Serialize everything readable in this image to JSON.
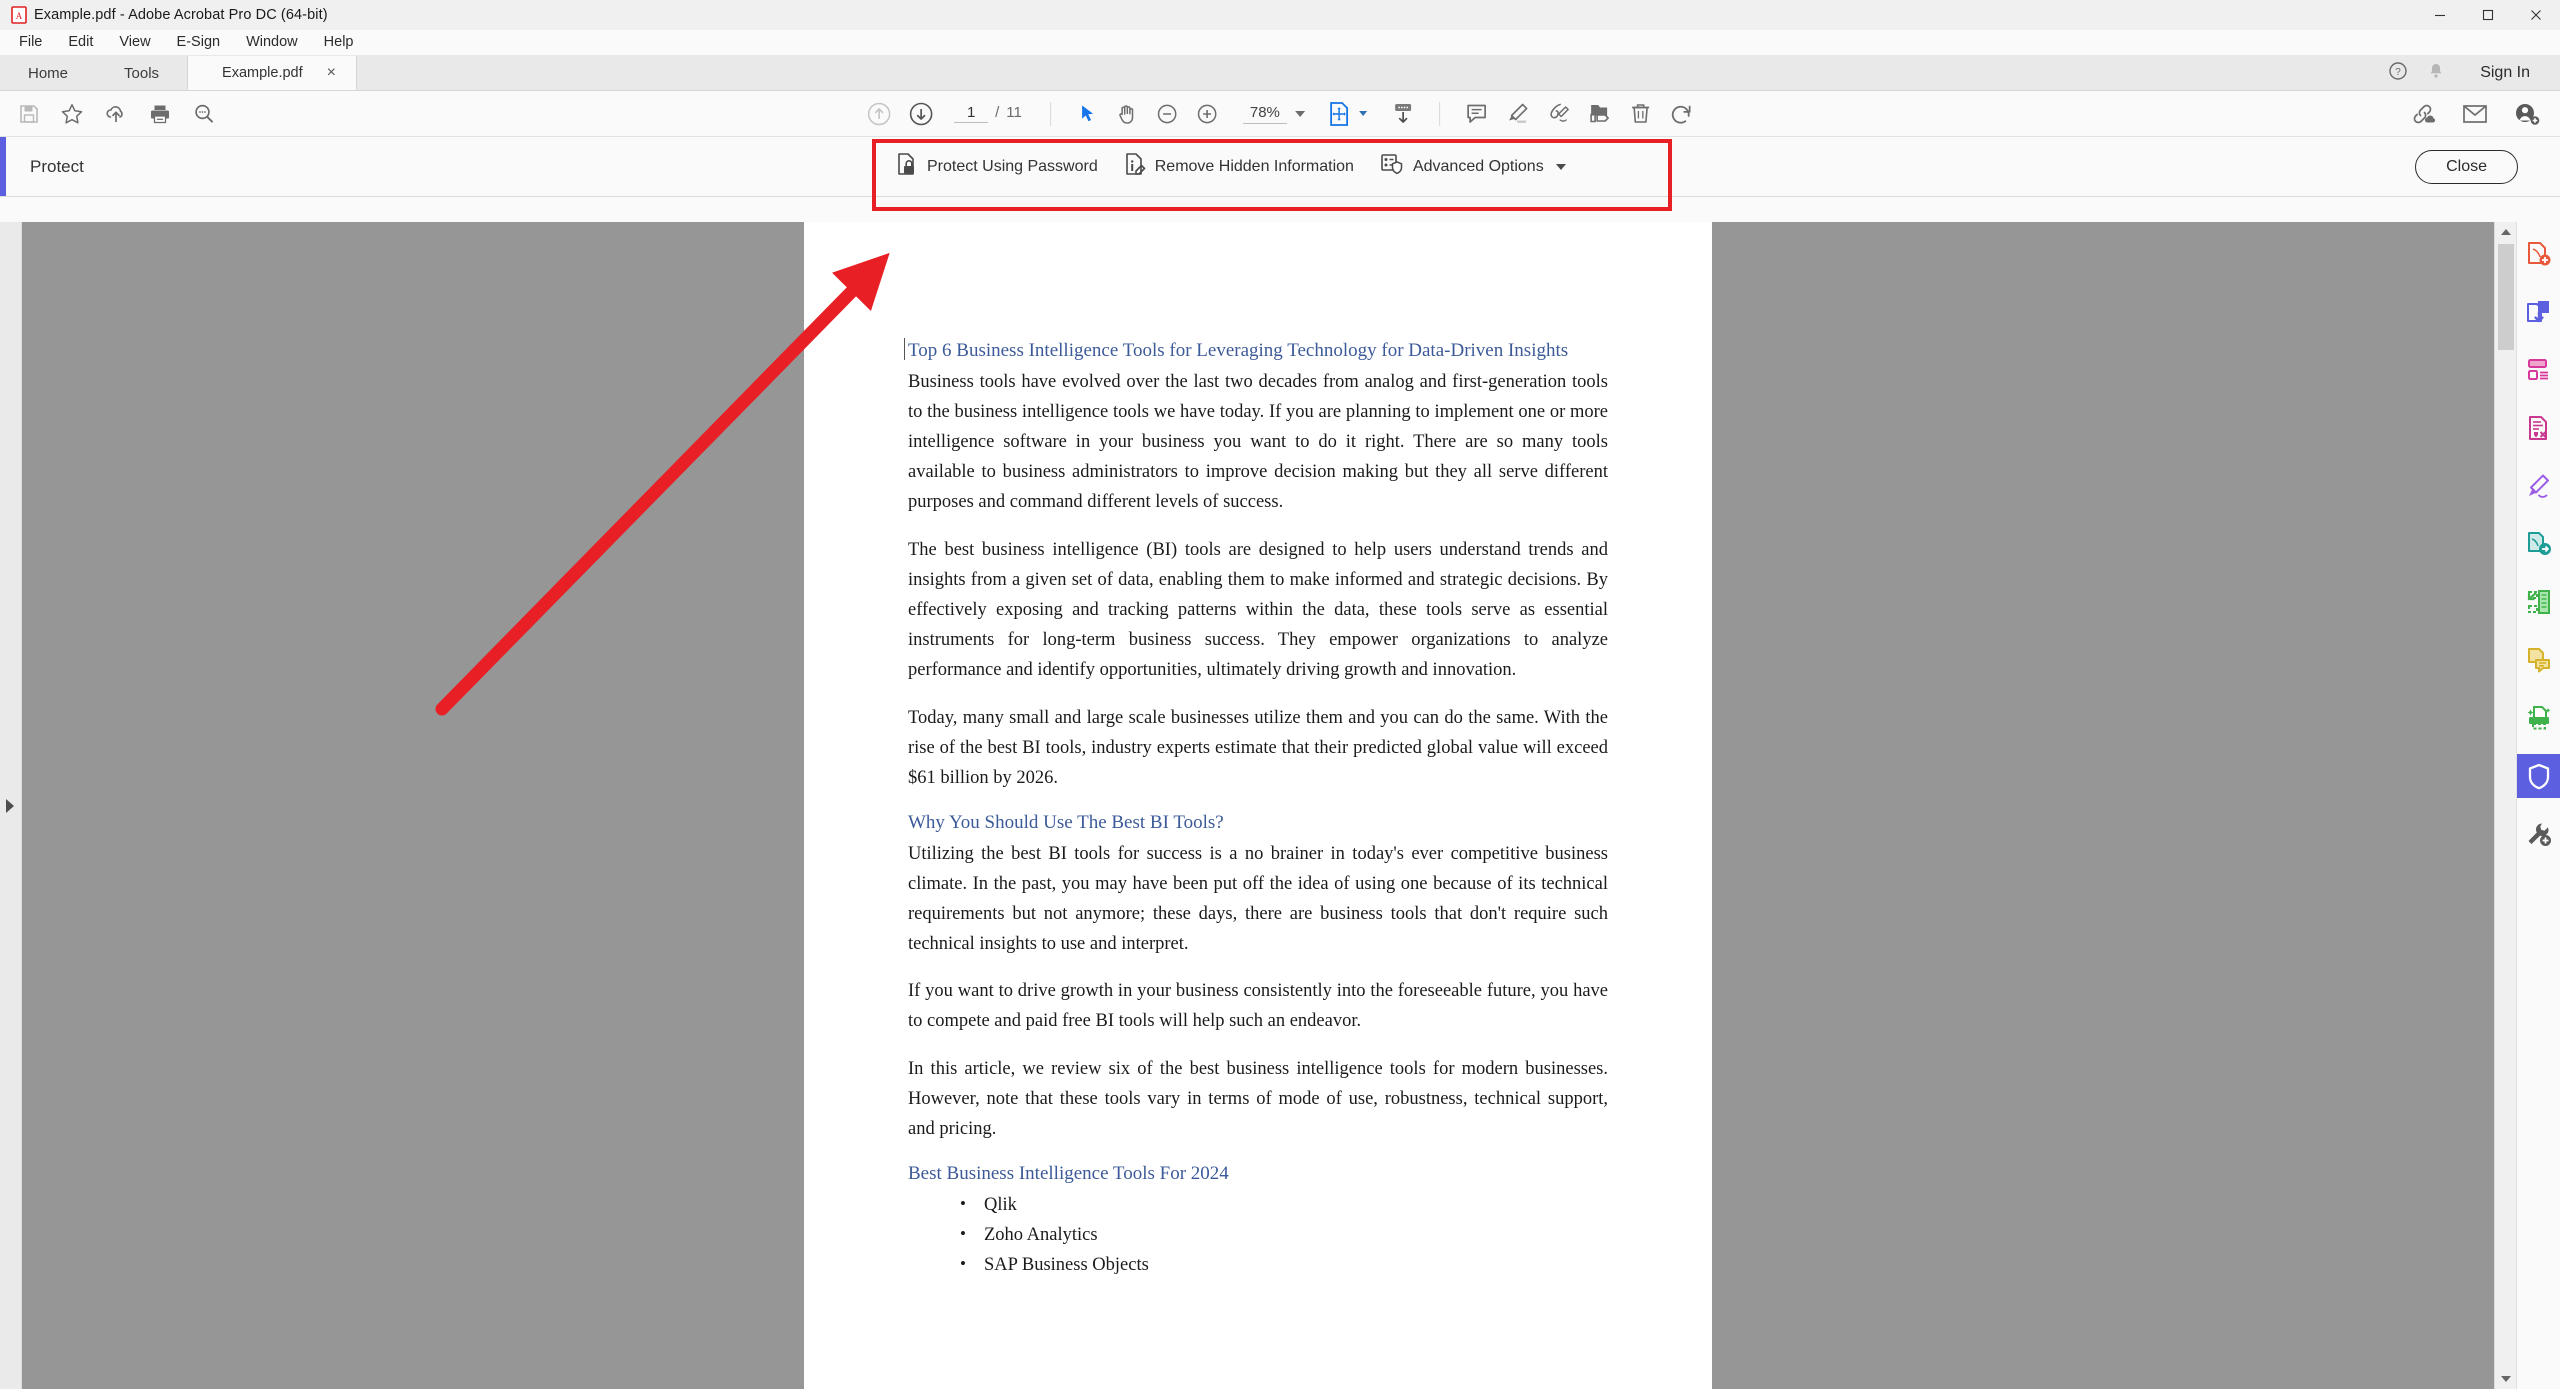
{
  "window": {
    "title": "Example.pdf - Adobe Acrobat Pro DC (64-bit)",
    "app_icon": "pdf-file-icon",
    "minimize": "—",
    "maximize": "❐",
    "close": "✕"
  },
  "menubar": {
    "items": [
      {
        "label": "File",
        "accel": "F"
      },
      {
        "label": "Edit",
        "accel": "E"
      },
      {
        "label": "View",
        "accel": "V"
      },
      {
        "label": "E-Sign",
        "accel": ""
      },
      {
        "label": "Window",
        "accel": "W"
      },
      {
        "label": "Help",
        "accel": "H"
      }
    ]
  },
  "tabs": {
    "home": "Home",
    "tools": "Tools",
    "document": "Example.pdf",
    "close_glyph": "×",
    "sign_in": "Sign In",
    "help_icon": "help-circle-icon",
    "bell_icon": "notification-bell-icon"
  },
  "toolbar": {
    "left_icons": [
      "save-icon",
      "star-icon",
      "cloud-upload-icon",
      "print-icon",
      "search-icon"
    ],
    "prev_page_icon": "arrow-up-circle-icon",
    "next_page_icon": "arrow-down-circle-icon",
    "page_current": "1",
    "page_sep": "/",
    "page_total": "11",
    "select_tool_icon": "cursor-select-icon",
    "hand_tool_icon": "hand-pan-icon",
    "zoom_out_icon": "zoom-out-icon",
    "zoom_in_icon": "zoom-in-icon",
    "zoom_value": "78%",
    "fit_page_icon": "fit-page-icon",
    "scroll_mode_icon": "page-scroll-icon",
    "comment_icon": "comment-icon",
    "highlight_icon": "highlight-marker-icon",
    "sign_icon": "sign-pen-icon",
    "stamp_icon": "stamp-icon",
    "delete_icon": "trash-icon",
    "undo_icon": "undo-icon",
    "right_icons": [
      "share-link-icon",
      "email-icon",
      "add-person-icon"
    ]
  },
  "protect": {
    "title": "Protect",
    "accent_color": "#5b5fe0",
    "highlight_color": "#e81f25",
    "actions": [
      {
        "label": "Protect Using Password",
        "icon": "lock-document-icon",
        "has_caret": false
      },
      {
        "label": "Remove Hidden Information",
        "icon": "info-document-icon",
        "has_caret": false
      },
      {
        "label": "Advanced Options",
        "icon": "shield-options-icon",
        "has_caret": true
      }
    ],
    "close_label": "Close"
  },
  "document": {
    "heading1": "Top 6 Business Intelligence Tools for Leveraging Technology for Data-Driven Insights",
    "para1": "Business tools have evolved over the last two decades from analog and first-generation tools to the business intelligence tools we have today.  If you are planning to implement one or more intelligence software in your business you want to do it right. There are so many tools available to business administrators to improve decision making but they all serve different purposes and command different levels of success.",
    "para2": "The best business intelligence (BI) tools are designed to help users understand trends and insights from a given set of data, enabling them to make informed and strategic decisions. By effectively exposing and tracking patterns within the data, these tools serve as essential instruments for long-term business success. They empower organizations to analyze performance and identify opportunities, ultimately driving growth and innovation.",
    "para3": "Today, many small and large scale businesses utilize them and you can do the same. With the rise of the best BI tools, industry experts estimate that their predicted global value will exceed $61 billion by 2026.",
    "heading2": "Why You Should Use The Best BI Tools?",
    "para4": "Utilizing the best BI tools for success is a no brainer in today's ever competitive business climate. In the past, you may have been put off the idea of using one because of its technical requirements but not anymore; these days, there are business tools that don't require such technical insights to use and interpret.",
    "para5": "If you want to drive growth in your business consistently into the foreseeable future, you have to compete and paid free BI tools will help such an endeavor.",
    "para6": "In this article, we review six of the best business intelligence tools for modern businesses. However, note that these tools vary in terms of mode of use, robustness, technical support, and pricing.",
    "heading3": "Best Business Intelligence Tools For 2024",
    "list": [
      "Qlik",
      "Zoho Analytics",
      "SAP Business Objects"
    ]
  },
  "toolrail": {
    "items": [
      {
        "name": "create-pdf-icon",
        "color": "#e8593c"
      },
      {
        "name": "export-pdf-icon",
        "color": "#5b5fe0"
      },
      {
        "name": "organize-pages-icon",
        "color": "#d6389c"
      },
      {
        "name": "redact-icon",
        "color": "#c9388f"
      },
      {
        "name": "fill-and-sign-icon",
        "color": "#9b5de5"
      },
      {
        "name": "send-for-signature-icon",
        "color": "#1e9c96"
      },
      {
        "name": "compare-files-icon",
        "color": "#3fb24c"
      },
      {
        "name": "comment-tool-icon",
        "color": "#d6b12b"
      },
      {
        "name": "enhance-scans-icon",
        "color": "#3fb24c"
      },
      {
        "name": "protect-shield-icon",
        "color": "#ffffff",
        "active": true
      },
      {
        "name": "more-tools-icon",
        "color": "#5a5a5a"
      }
    ]
  }
}
